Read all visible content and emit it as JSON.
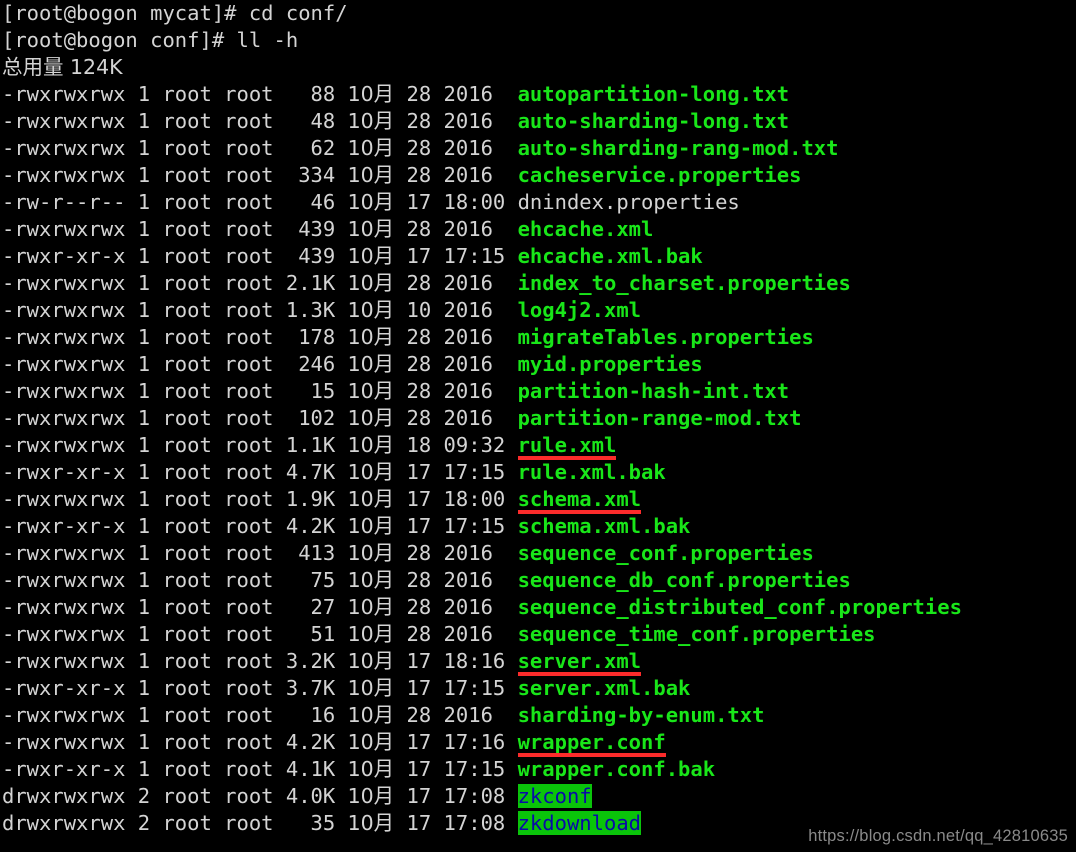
{
  "terminal": {
    "background_color": "#000000",
    "foreground_color": "#d4d4d4",
    "exec_file_color": "#19e619",
    "dir_text_color": "#0a0aa8",
    "dir_bg_color": "#0ac40a",
    "highlight_color": "#fc2b2b",
    "prompt_lines": [
      "[root@bogon mycat]# cd conf/",
      "[root@bogon conf]# ll -h"
    ],
    "total_line": "总用量 124K",
    "month_label": "10月",
    "rows": [
      {
        "perms": "-rwxrwxrwx",
        "links": "1",
        "owner": "root",
        "group": "root",
        "size": "88",
        "month": "10月",
        "day": "28",
        "time": "2016",
        "name": "autopartition-long.txt",
        "kind": "exec",
        "underlined": false
      },
      {
        "perms": "-rwxrwxrwx",
        "links": "1",
        "owner": "root",
        "group": "root",
        "size": "48",
        "month": "10月",
        "day": "28",
        "time": "2016",
        "name": "auto-sharding-long.txt",
        "kind": "exec",
        "underlined": false
      },
      {
        "perms": "-rwxrwxrwx",
        "links": "1",
        "owner": "root",
        "group": "root",
        "size": "62",
        "month": "10月",
        "day": "28",
        "time": "2016",
        "name": "auto-sharding-rang-mod.txt",
        "kind": "exec",
        "underlined": false
      },
      {
        "perms": "-rwxrwxrwx",
        "links": "1",
        "owner": "root",
        "group": "root",
        "size": "334",
        "month": "10月",
        "day": "28",
        "time": "2016",
        "name": "cacheservice.properties",
        "kind": "exec",
        "underlined": false
      },
      {
        "perms": "-rw-r--r--",
        "links": "1",
        "owner": "root",
        "group": "root",
        "size": "46",
        "month": "10月",
        "day": "17",
        "time": "18:00",
        "name": "dnindex.properties",
        "kind": "plain",
        "underlined": false
      },
      {
        "perms": "-rwxrwxrwx",
        "links": "1",
        "owner": "root",
        "group": "root",
        "size": "439",
        "month": "10月",
        "day": "28",
        "time": "2016",
        "name": "ehcache.xml",
        "kind": "exec",
        "underlined": false
      },
      {
        "perms": "-rwxr-xr-x",
        "links": "1",
        "owner": "root",
        "group": "root",
        "size": "439",
        "month": "10月",
        "day": "17",
        "time": "17:15",
        "name": "ehcache.xml.bak",
        "kind": "exec",
        "underlined": false
      },
      {
        "perms": "-rwxrwxrwx",
        "links": "1",
        "owner": "root",
        "group": "root",
        "size": "2.1K",
        "month": "10月",
        "day": "28",
        "time": "2016",
        "name": "index_to_charset.properties",
        "kind": "exec",
        "underlined": false
      },
      {
        "perms": "-rwxrwxrwx",
        "links": "1",
        "owner": "root",
        "group": "root",
        "size": "1.3K",
        "month": "10月",
        "day": "10",
        "time": "2016",
        "name": "log4j2.xml",
        "kind": "exec",
        "underlined": false
      },
      {
        "perms": "-rwxrwxrwx",
        "links": "1",
        "owner": "root",
        "group": "root",
        "size": "178",
        "month": "10月",
        "day": "28",
        "time": "2016",
        "name": "migrateTables.properties",
        "kind": "exec",
        "underlined": false
      },
      {
        "perms": "-rwxrwxrwx",
        "links": "1",
        "owner": "root",
        "group": "root",
        "size": "246",
        "month": "10月",
        "day": "28",
        "time": "2016",
        "name": "myid.properties",
        "kind": "exec",
        "underlined": false
      },
      {
        "perms": "-rwxrwxrwx",
        "links": "1",
        "owner": "root",
        "group": "root",
        "size": "15",
        "month": "10月",
        "day": "28",
        "time": "2016",
        "name": "partition-hash-int.txt",
        "kind": "exec",
        "underlined": false
      },
      {
        "perms": "-rwxrwxrwx",
        "links": "1",
        "owner": "root",
        "group": "root",
        "size": "102",
        "month": "10月",
        "day": "28",
        "time": "2016",
        "name": "partition-range-mod.txt",
        "kind": "exec",
        "underlined": false
      },
      {
        "perms": "-rwxrwxrwx",
        "links": "1",
        "owner": "root",
        "group": "root",
        "size": "1.1K",
        "month": "10月",
        "day": "18",
        "time": "09:32",
        "name": "rule.xml",
        "kind": "exec",
        "underlined": true
      },
      {
        "perms": "-rwxr-xr-x",
        "links": "1",
        "owner": "root",
        "group": "root",
        "size": "4.7K",
        "month": "10月",
        "day": "17",
        "time": "17:15",
        "name": "rule.xml.bak",
        "kind": "exec",
        "underlined": false
      },
      {
        "perms": "-rwxrwxrwx",
        "links": "1",
        "owner": "root",
        "group": "root",
        "size": "1.9K",
        "month": "10月",
        "day": "17",
        "time": "18:00",
        "name": "schema.xml",
        "kind": "exec",
        "underlined": true
      },
      {
        "perms": "-rwxr-xr-x",
        "links": "1",
        "owner": "root",
        "group": "root",
        "size": "4.2K",
        "month": "10月",
        "day": "17",
        "time": "17:15",
        "name": "schema.xml.bak",
        "kind": "exec",
        "underlined": false
      },
      {
        "perms": "-rwxrwxrwx",
        "links": "1",
        "owner": "root",
        "group": "root",
        "size": "413",
        "month": "10月",
        "day": "28",
        "time": "2016",
        "name": "sequence_conf.properties",
        "kind": "exec",
        "underlined": false
      },
      {
        "perms": "-rwxrwxrwx",
        "links": "1",
        "owner": "root",
        "group": "root",
        "size": "75",
        "month": "10月",
        "day": "28",
        "time": "2016",
        "name": "sequence_db_conf.properties",
        "kind": "exec",
        "underlined": false
      },
      {
        "perms": "-rwxrwxrwx",
        "links": "1",
        "owner": "root",
        "group": "root",
        "size": "27",
        "month": "10月",
        "day": "28",
        "time": "2016",
        "name": "sequence_distributed_conf.properties",
        "kind": "exec",
        "underlined": false
      },
      {
        "perms": "-rwxrwxrwx",
        "links": "1",
        "owner": "root",
        "group": "root",
        "size": "51",
        "month": "10月",
        "day": "28",
        "time": "2016",
        "name": "sequence_time_conf.properties",
        "kind": "exec",
        "underlined": false
      },
      {
        "perms": "-rwxrwxrwx",
        "links": "1",
        "owner": "root",
        "group": "root",
        "size": "3.2K",
        "month": "10月",
        "day": "17",
        "time": "18:16",
        "name": "server.xml",
        "kind": "exec",
        "underlined": true
      },
      {
        "perms": "-rwxr-xr-x",
        "links": "1",
        "owner": "root",
        "group": "root",
        "size": "3.7K",
        "month": "10月",
        "day": "17",
        "time": "17:15",
        "name": "server.xml.bak",
        "kind": "exec",
        "underlined": false
      },
      {
        "perms": "-rwxrwxrwx",
        "links": "1",
        "owner": "root",
        "group": "root",
        "size": "16",
        "month": "10月",
        "day": "28",
        "time": "2016",
        "name": "sharding-by-enum.txt",
        "kind": "exec",
        "underlined": false
      },
      {
        "perms": "-rwxrwxrwx",
        "links": "1",
        "owner": "root",
        "group": "root",
        "size": "4.2K",
        "month": "10月",
        "day": "17",
        "time": "17:16",
        "name": "wrapper.conf",
        "kind": "exec",
        "underlined": true
      },
      {
        "perms": "-rwxr-xr-x",
        "links": "1",
        "owner": "root",
        "group": "root",
        "size": "4.1K",
        "month": "10月",
        "day": "17",
        "time": "17:15",
        "name": "wrapper.conf.bak",
        "kind": "exec",
        "underlined": false
      },
      {
        "perms": "drwxrwxrwx",
        "links": "2",
        "owner": "root",
        "group": "root",
        "size": "4.0K",
        "month": "10月",
        "day": "17",
        "time": "17:08",
        "name": "zkconf",
        "kind": "dir",
        "underlined": false
      },
      {
        "perms": "drwxrwxrwx",
        "links": "2",
        "owner": "root",
        "group": "root",
        "size": "35",
        "month": "10月",
        "day": "17",
        "time": "17:08",
        "name": "zkdownload",
        "kind": "dir",
        "underlined": false
      }
    ],
    "watermark": "https://blog.csdn.net/qq_42810635"
  }
}
